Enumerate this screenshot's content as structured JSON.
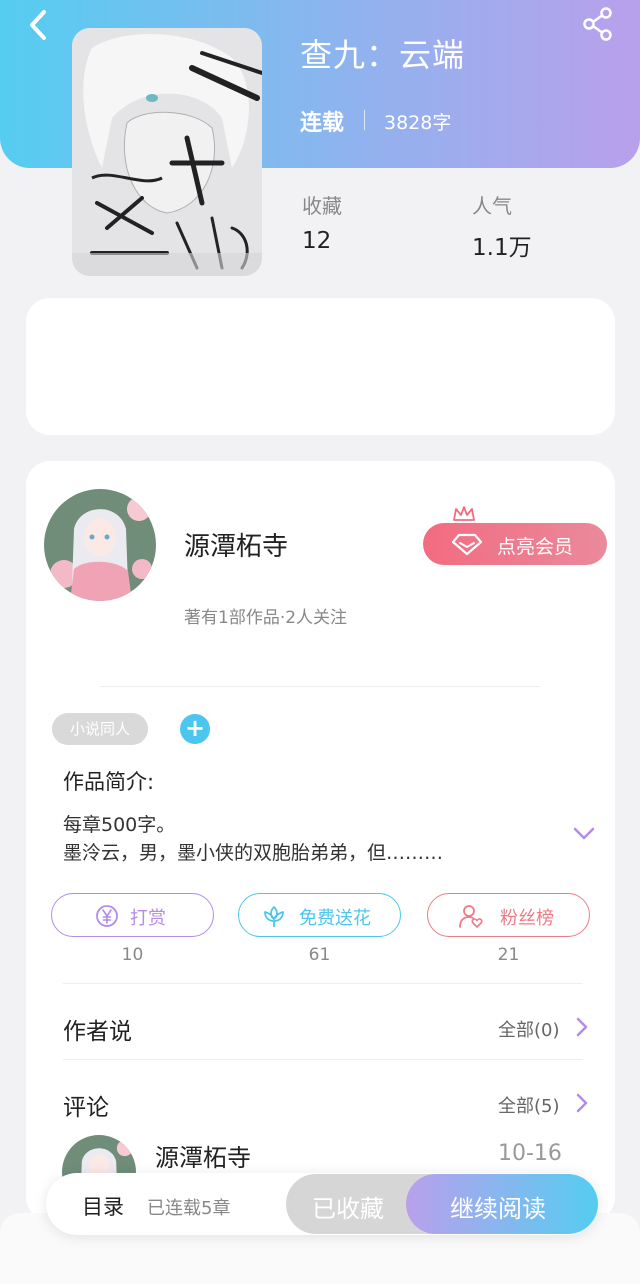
{
  "book": {
    "title": "查九：云端",
    "status": "连载",
    "word_count": "3828字",
    "favorites_label": "收藏",
    "favorites_value": "12",
    "popularity_label": "人气",
    "popularity_value": "1.1万"
  },
  "author": {
    "name": "源潭柘寺",
    "meta": "著有1部作品·2人关注",
    "vip_button": "点亮会员"
  },
  "tags": {
    "genre": "小说同人",
    "add_icon": "+"
  },
  "intro": {
    "heading": "作品简介:",
    "line1": "每章500字。",
    "line2": "墨泠云，男，墨小侠的双胞胎弟弟，但………"
  },
  "actions": [
    {
      "label": "打赏",
      "count": "10",
      "icon": "yen-coin-icon",
      "color": "#b48be6"
    },
    {
      "label": "免费送花",
      "count": "61",
      "icon": "flower-icon",
      "color": "#4cc6ee"
    },
    {
      "label": "粉丝榜",
      "count": "21",
      "icon": "user-heart-icon",
      "color": "#ee7b85"
    }
  ],
  "author_says": {
    "title": "作者说",
    "link": "全部(0)"
  },
  "comments": {
    "title": "评论",
    "link": "全部(5)",
    "items": [
      {
        "name": "源潭柘寺",
        "date": "10-16"
      }
    ]
  },
  "bottom": {
    "toc": "目录",
    "toc_sub": "已连载5章",
    "collected": "已收藏",
    "continue": "继续阅读"
  },
  "colors": {
    "header_start": "#55cdf0",
    "header_end": "#b9a0ec",
    "vip": "#f36b80",
    "accent_blue": "#4cc6ee",
    "accent_purple": "#b48be6"
  }
}
